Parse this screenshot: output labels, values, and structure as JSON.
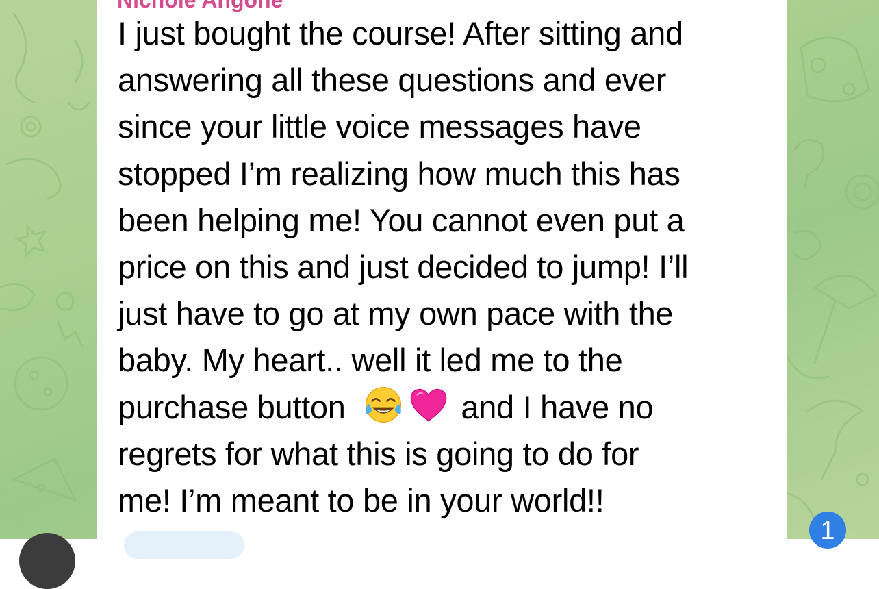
{
  "chat": {
    "sender_name": "Nichole Angone",
    "message_lines": [
      "I just bought the course! After sitting and",
      "answering all these questions and ever",
      "since your little voice messages have",
      "stopped I’m realizing how much this has",
      "been helping me! You cannot even put a",
      "price on this and just decided to jump! I’ll",
      "just have to go at my own pace with the",
      "baby. My heart.. well it led me to the",
      "purchase button",
      "and I have no",
      "regrets for what this is going to do for",
      "me! I’m meant to be in your world!!"
    ],
    "emojis": [
      "face-with-tears-of-joy-icon",
      "pink-heart-icon"
    ]
  },
  "badge": {
    "unread_count": "1"
  },
  "colors": {
    "background": "#a9cf8f",
    "bubble": "#ffffff",
    "sender_name": "#d44c8f",
    "badge": "#2f7fe4"
  }
}
